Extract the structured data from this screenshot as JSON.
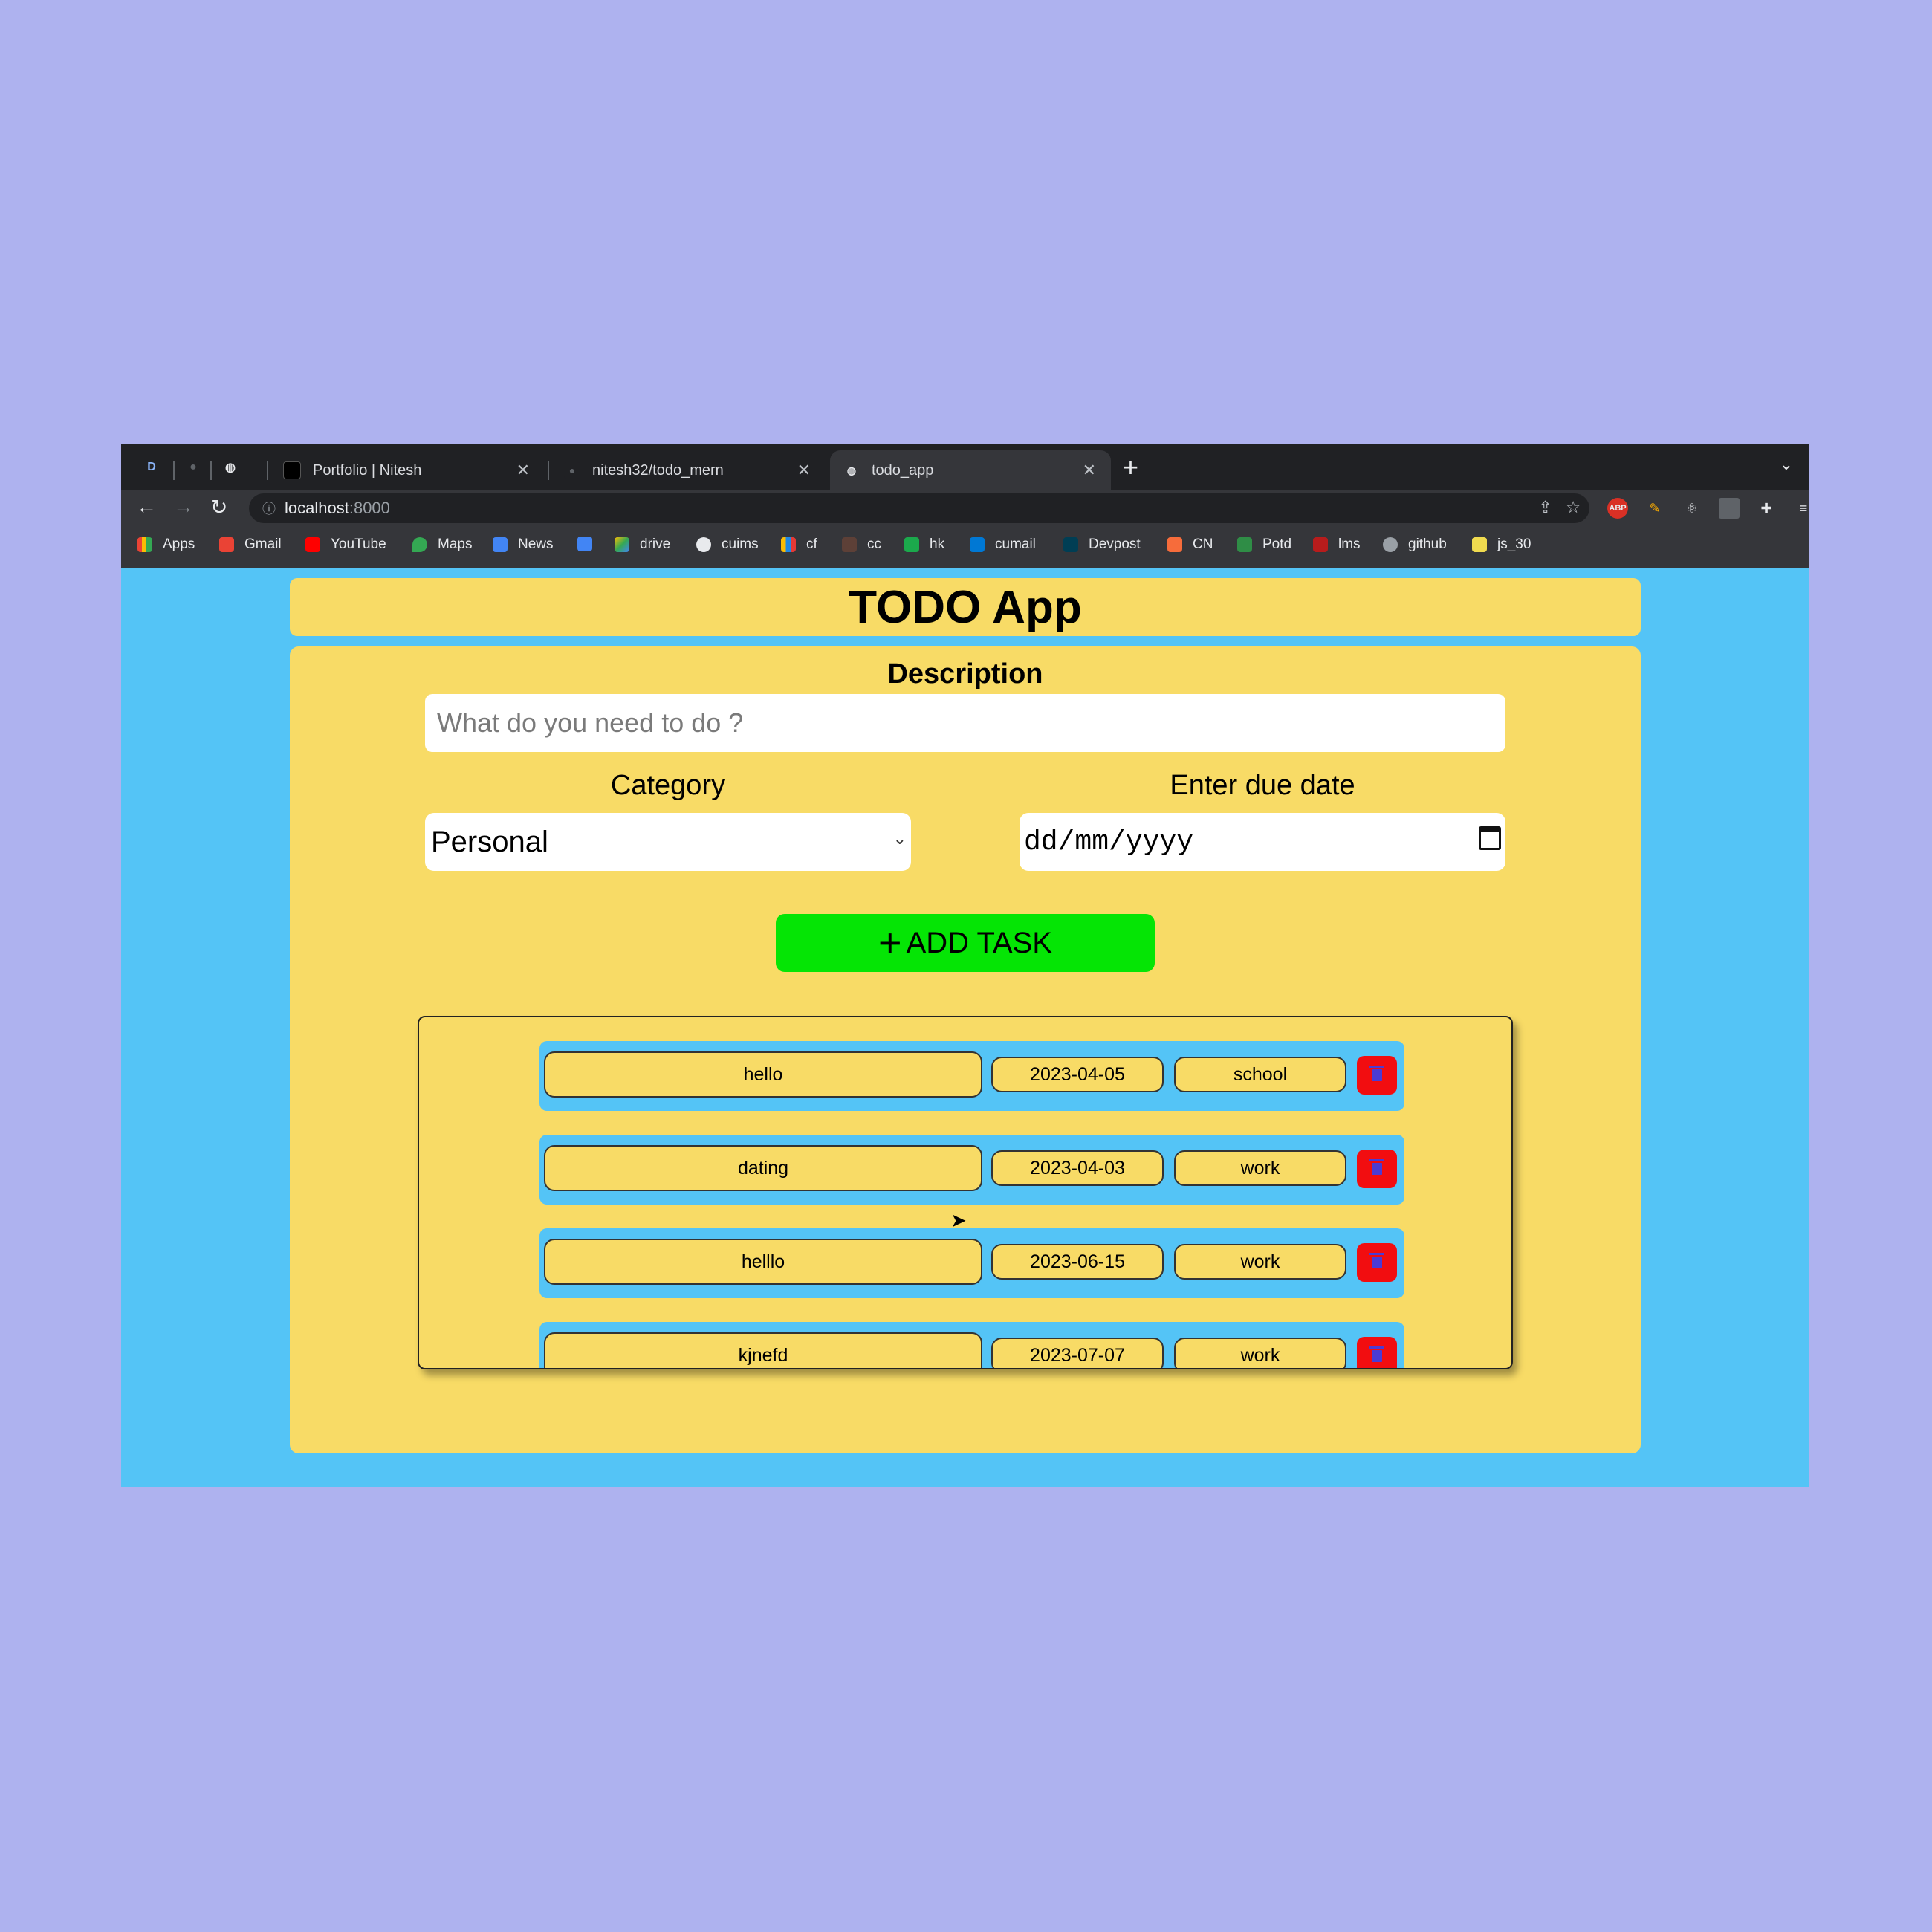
{
  "browser": {
    "tabs": [
      {
        "title": "Portfolio | Nitesh"
      },
      {
        "title": "nitesh32/todo_mern"
      },
      {
        "title": "todo_app"
      }
    ],
    "pinned_tab_letter": "D",
    "url_host": "localhost",
    "url_port": ":8000",
    "bookmarks": [
      "Apps",
      "Gmail",
      "YouTube",
      "Maps",
      "News",
      "drive",
      "cuims",
      "cf",
      "cc",
      "hk",
      "cumail",
      "Devpost",
      "CN",
      "Potd",
      "lms",
      "github",
      "js_30"
    ],
    "extension_abp": "ABP"
  },
  "app": {
    "title": "TODO App",
    "description_label": "Description",
    "description_placeholder": "What do you need to do ?",
    "category_label": "Category",
    "category_value": "Personal",
    "due_label": "Enter due date",
    "due_placeholder": "dd/mm/yyyy",
    "add_button": "ADD TASK",
    "add_button_plus": "+"
  },
  "tasks": [
    {
      "name": "hello",
      "date": "2023-04-05",
      "category": "school"
    },
    {
      "name": "dating",
      "date": "2023-04-03",
      "category": "work"
    },
    {
      "name": "helllo",
      "date": "2023-06-15",
      "category": "work"
    },
    {
      "name": "kjnefd",
      "date": "2023-07-07",
      "category": "work"
    }
  ],
  "colors": {
    "background": "#aeb2ef",
    "page": "#54c4f6",
    "card": "#f8db66",
    "add_button": "#05e505",
    "delete_button": "#f20d10"
  }
}
